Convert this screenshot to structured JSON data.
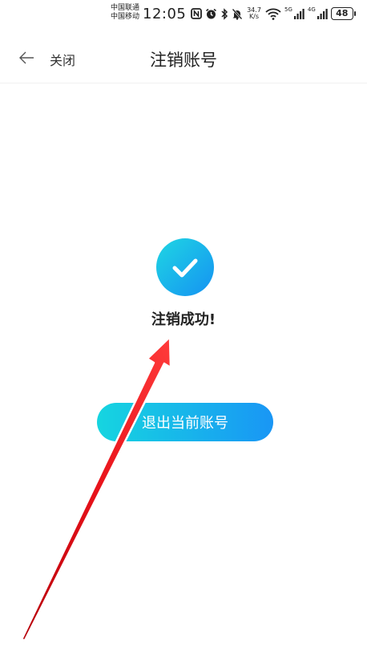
{
  "status_bar": {
    "carrier_1": "中国联通",
    "carrier_2": "中国移动",
    "time": "12:05",
    "net_speed_value": "34.7",
    "net_speed_unit": "K/s",
    "signal_1_label": "5G",
    "signal_2_label": "4G",
    "battery": "48"
  },
  "header": {
    "back_label": "关闭",
    "title": "注销账号"
  },
  "main": {
    "success_message": "注销成功!",
    "logout_button_label": "退出当前账号"
  },
  "colors": {
    "accent_start": "#16d5e0",
    "accent_end": "#1996f5",
    "annotation_arrow": "#e8121a"
  }
}
